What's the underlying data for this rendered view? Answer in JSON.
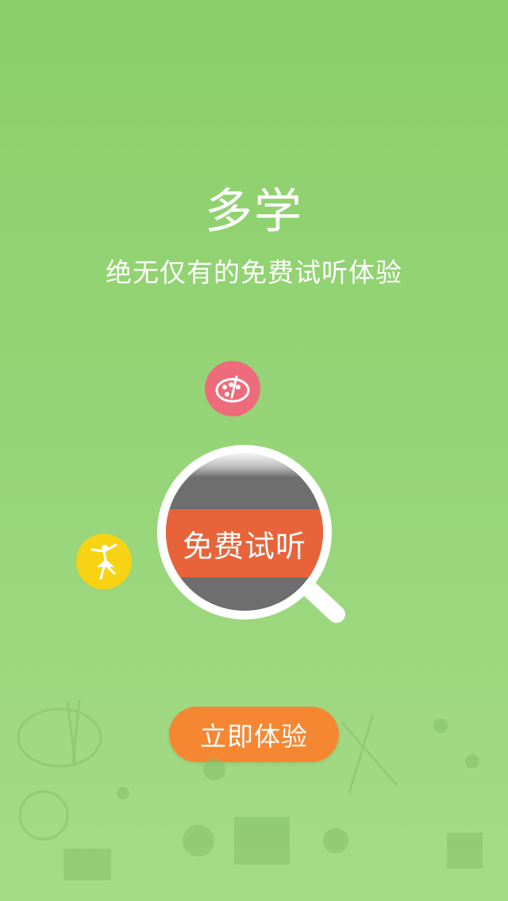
{
  "header": {
    "title": "多学",
    "subtitle": "绝无仅有的免费试听体验"
  },
  "lens": {
    "label": "免费试听"
  },
  "cta": {
    "label": "立即体验"
  },
  "icons": {
    "palette": "palette-icon",
    "dancer": "dancer-icon",
    "magnifier": "magnifier-icon"
  },
  "colors": {
    "background_top": "#8bd068",
    "background_bottom": "#a5db86",
    "palette_bubble": "#ee6b7c",
    "dancer_bubble": "#f7d314",
    "lens_band": "#e8633a",
    "cta": "#f68732"
  }
}
